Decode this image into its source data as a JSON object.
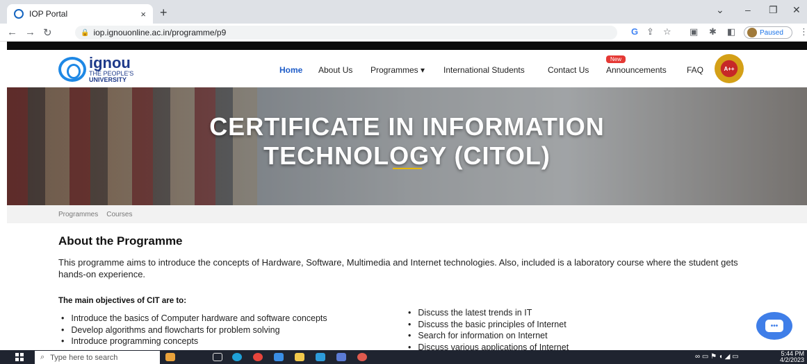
{
  "browser": {
    "tab_title": "IOP Portal",
    "tab_close": "×",
    "new_tab": "+",
    "url": "iop.ignouonline.ac.in/programme/p9",
    "profile_status": "Paused"
  },
  "site": {
    "logo_name": "ignou",
    "logo_tagline_1": "THE PEOPLE'S",
    "logo_tagline_2": "UNIVERSITY",
    "nav": {
      "home": "Home",
      "about": "About Us",
      "programmes": "Programmes ▾",
      "international": "International Students",
      "contact": "Contact Us",
      "announcements": "Announcements",
      "new_badge": "New",
      "faq": "FAQ"
    },
    "naac_badge": "A++"
  },
  "hero": {
    "title_line1": "CERTIFICATE IN INFORMATION",
    "title_line2": "TECHNOLOGY (CITOL)"
  },
  "breadcrumb": [
    "Programmes",
    "Courses"
  ],
  "content": {
    "about_title": "About the Programme",
    "about_text": "This programme aims to introduce the concepts of Hardware, Software, Multimedia and Internet technologies. Also, included is a laboratory course where the student gets hands-on experience.",
    "objectives_title": "The main objectives of CIT are to:",
    "objectives_left": [
      "Introduce the basics of Computer hardware and software concepts",
      "Develop algorithms and flowcharts for problem solving",
      "Introduce programming concepts"
    ],
    "objectives_right": [
      "Discuss the latest trends in IT",
      "Discuss the basic principles of Internet",
      "Search for information on Internet",
      "Discuss various applications of Internet"
    ]
  },
  "taskbar": {
    "search_placeholder": "Type here to search",
    "time": "5:44 PM",
    "date": "4/2/2023"
  },
  "colors": {
    "accent": "#1e5cc8",
    "new_badge": "#e53935",
    "chat": "#3f7ee8"
  }
}
